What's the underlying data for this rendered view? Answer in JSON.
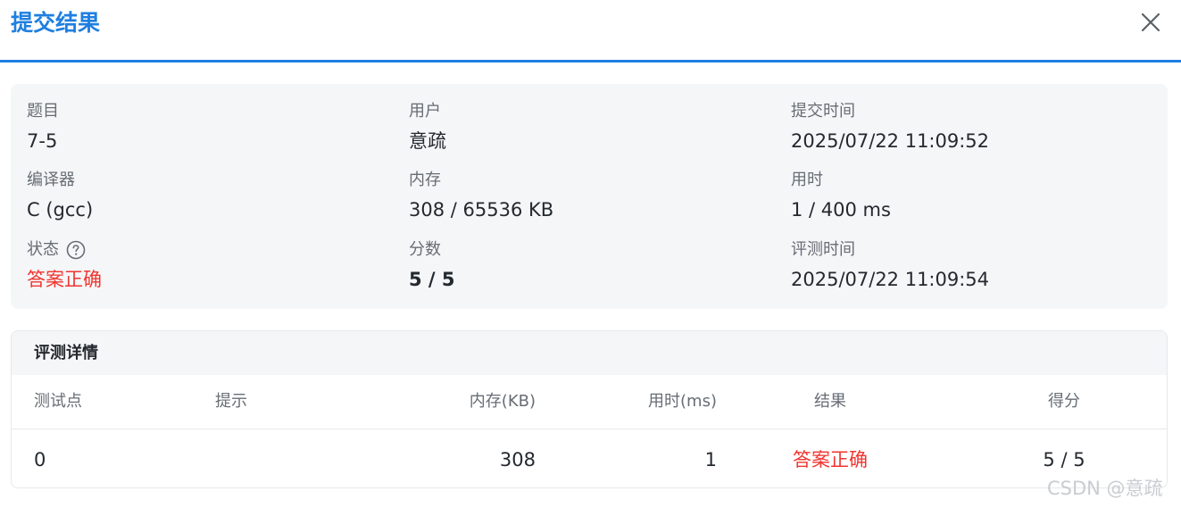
{
  "dialog": {
    "title": "提交结果"
  },
  "info": {
    "problem": {
      "label": "题目",
      "value": "7-5"
    },
    "user": {
      "label": "用户",
      "value": "意疏"
    },
    "submit_time": {
      "label": "提交时间",
      "value": "2025/07/22 11:09:52"
    },
    "compiler": {
      "label": "编译器",
      "value": "C (gcc)"
    },
    "memory": {
      "label": "内存",
      "value": "308 / 65536 KB"
    },
    "time_used": {
      "label": "用时",
      "value": "1 / 400 ms"
    },
    "status": {
      "label": "状态",
      "value": "答案正确",
      "icon": "help-circle-icon"
    },
    "score": {
      "label": "分数",
      "value": "5 / 5"
    },
    "judge_time": {
      "label": "评测时间",
      "value": "2025/07/22 11:09:54"
    }
  },
  "details": {
    "title": "评测详情",
    "columns": [
      "测试点",
      "提示",
      "内存(KB)",
      "用时(ms)",
      "结果",
      "得分"
    ],
    "rows": [
      {
        "case": "0",
        "hint": "",
        "memory": "308",
        "time": "1",
        "result": "答案正确",
        "score": "5 / 5"
      }
    ]
  },
  "colors": {
    "accent": "#1f7fe0",
    "status_accepted": "#f0352f",
    "card_bg": "#f5f6f8"
  },
  "watermark": "CSDN @意疏"
}
